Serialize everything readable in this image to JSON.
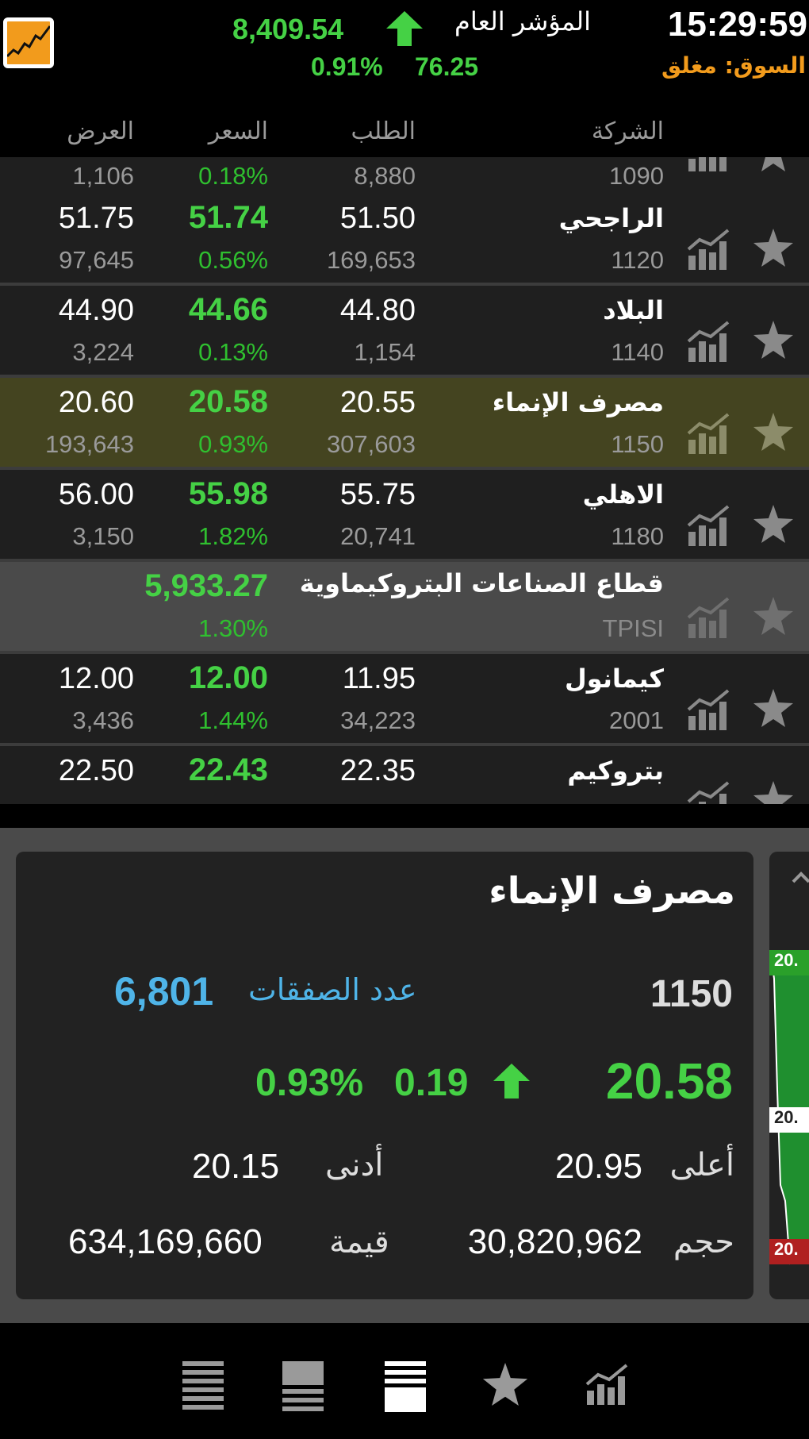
{
  "header": {
    "time": "15:29:59",
    "market_status": "السوق: مغلق",
    "index_label": "المؤشر العام",
    "index_value": "8,409.54",
    "index_change": "76.25",
    "index_change_pct": "0.91%",
    "accent_green": "#45d145",
    "accent_orange": "#f29b1c"
  },
  "columns": {
    "company": "الشركة",
    "bid": "الطلب",
    "price": "السعر",
    "ask": "العرض"
  },
  "rows": [
    {
      "name": "",
      "code": "1090",
      "bid": "",
      "bid_qty": "8,880",
      "price": "",
      "pct": "0.18%",
      "ask": "",
      "ask_qty": "1,106"
    },
    {
      "name": "الراجحي",
      "code": "1120",
      "bid": "51.50",
      "bid_qty": "169,653",
      "price": "51.74",
      "pct": "0.56%",
      "ask": "51.75",
      "ask_qty": "97,645"
    },
    {
      "name": "البلاد",
      "code": "1140",
      "bid": "44.80",
      "bid_qty": "1,154",
      "price": "44.66",
      "pct": "0.13%",
      "ask": "44.90",
      "ask_qty": "3,224"
    },
    {
      "name": "مصرف الإنماء",
      "code": "1150",
      "bid": "20.55",
      "bid_qty": "307,603",
      "price": "20.58",
      "pct": "0.93%",
      "ask": "20.60",
      "ask_qty": "193,643",
      "selected": true
    },
    {
      "name": "الاهلي",
      "code": "1180",
      "bid": "55.75",
      "bid_qty": "20,741",
      "price": "55.98",
      "pct": "1.82%",
      "ask": "56.00",
      "ask_qty": "3,150"
    },
    {
      "name": "قطاع الصناعات البتروكيماوية",
      "code": "TPISI",
      "bid": "",
      "bid_qty": "",
      "price": "5,933.27",
      "pct": "1.30%",
      "ask": "",
      "ask_qty": "",
      "sector": true
    },
    {
      "name": "كيمانول",
      "code": "2001",
      "bid": "11.95",
      "bid_qty": "34,223",
      "price": "12.00",
      "pct": "1.44%",
      "ask": "12.00",
      "ask_qty": "3,436"
    },
    {
      "name": "بتروكيم",
      "code": "",
      "bid": "22.35",
      "bid_qty": "",
      "price": "22.43",
      "pct": "",
      "ask": "22.50",
      "ask_qty": ""
    }
  ],
  "detail": {
    "name": "مصرف الإنماء",
    "code": "1150",
    "trades_label": "عدد الصفقات",
    "trades_value": "6,801",
    "price": "20.58",
    "change": "0.19",
    "change_pct": "0.93%",
    "high_label": "أعلى",
    "high_value": "20.95",
    "low_label": "أدنى",
    "low_value": "20.15",
    "volume_label": "حجم",
    "volume_value": "30,820,962",
    "value_label": "قيمة",
    "value_value": "634,169,660"
  },
  "peek_chart": {
    "labels": [
      "20.",
      "20.",
      "20."
    ]
  },
  "bottom_nav": [
    "list-large-icon",
    "list-compact-icon",
    "list-detail-icon",
    "favorites-star-icon",
    "chart-icon"
  ]
}
